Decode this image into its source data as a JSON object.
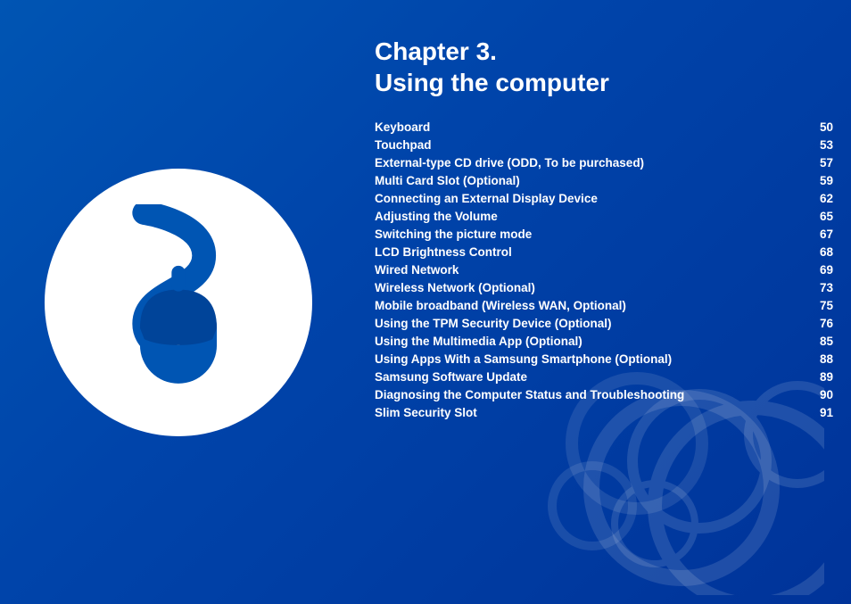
{
  "chapter": {
    "title_line1": "Chapter 3.",
    "title_line2": "Using the computer"
  },
  "toc": {
    "items": [
      {
        "label": "Keyboard",
        "page": "50"
      },
      {
        "label": "Touchpad",
        "page": "53"
      },
      {
        "label": "External-type CD drive (ODD, To be purchased)",
        "page": "57"
      },
      {
        "label": "Multi Card Slot (Optional)",
        "page": "59"
      },
      {
        "label": "Connecting an External Display Device",
        "page": "62"
      },
      {
        "label": "Adjusting the Volume",
        "page": "65"
      },
      {
        "label": "Switching the picture mode",
        "page": "67"
      },
      {
        "label": "LCD Brightness Control",
        "page": "68"
      },
      {
        "label": "Wired Network",
        "page": "69"
      },
      {
        "label": "Wireless Network (Optional)",
        "page": "73"
      },
      {
        "label": "Mobile broadband (Wireless WAN, Optional)",
        "page": "75"
      },
      {
        "label": "Using the TPM Security Device (Optional)",
        "page": "76"
      },
      {
        "label": "Using the Multimedia App (Optional)",
        "page": "85"
      },
      {
        "label": "Using Apps With a Samsung Smartphone (Optional)",
        "page": "88"
      },
      {
        "label": "Samsung Software Update",
        "page": "89"
      },
      {
        "label": "Diagnosing the Computer Status and Troubleshooting",
        "page": "90"
      },
      {
        "label": "Slim Security Slot",
        "page": "91"
      }
    ]
  }
}
